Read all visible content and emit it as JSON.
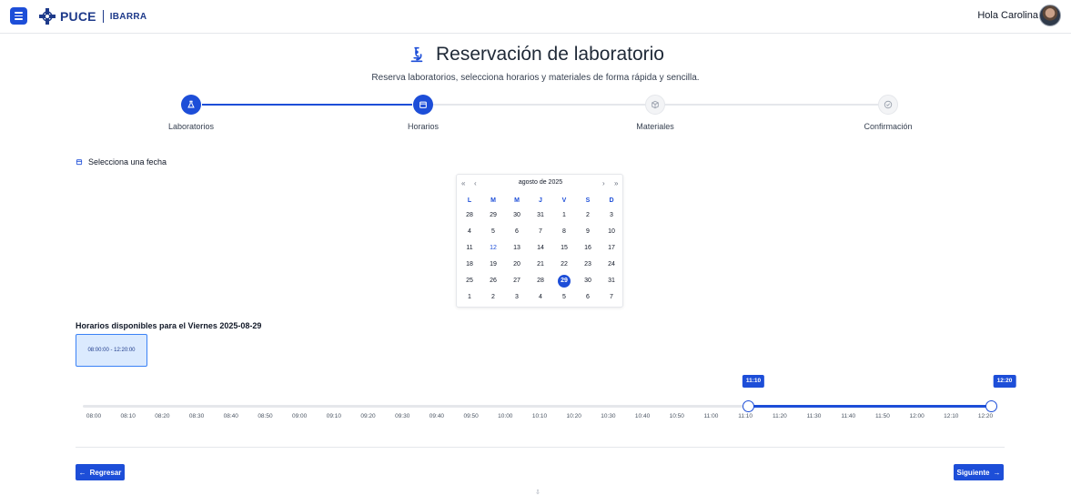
{
  "header": {
    "brand": "PUCE",
    "brand_sub": "IBARRA",
    "greeting": "Hola Carolina",
    "menu_icon": "hamburger-icon"
  },
  "page": {
    "title": "Reservación de laboratorio",
    "title_icon": "microscope-icon",
    "subtitle": "Reserva laboratorios, selecciona horarios y materiales de forma rápida y sencilla."
  },
  "stepper": {
    "steps": [
      {
        "label": "Laboratorios",
        "icon": "flask-icon",
        "state": "completed"
      },
      {
        "label": "Horarios",
        "icon": "calendar-icon",
        "state": "active"
      },
      {
        "label": "Materiales",
        "icon": "box-icon",
        "state": "pending"
      },
      {
        "label": "Confirmación",
        "icon": "check-circle-icon",
        "state": "pending"
      }
    ]
  },
  "date_section": {
    "label": "Selecciona una fecha"
  },
  "calendar": {
    "month_label": "agosto de 2025",
    "nav": {
      "prev_year": "«",
      "prev_month": "‹",
      "next_month": "›",
      "next_year": "»"
    },
    "weekdays": [
      "L",
      "M",
      "M",
      "J",
      "V",
      "S",
      "D"
    ],
    "weeks": [
      [
        "28",
        "29",
        "30",
        "31",
        "1",
        "2",
        "3"
      ],
      [
        "4",
        "5",
        "6",
        "7",
        "8",
        "9",
        "10"
      ],
      [
        "11",
        "12",
        "13",
        "14",
        "15",
        "16",
        "17"
      ],
      [
        "18",
        "19",
        "20",
        "21",
        "22",
        "23",
        "24"
      ],
      [
        "25",
        "26",
        "27",
        "28",
        "29",
        "30",
        "31"
      ],
      [
        "1",
        "2",
        "3",
        "4",
        "5",
        "6",
        "7"
      ]
    ],
    "today": "12",
    "selected": "29"
  },
  "slots": {
    "title": "Horarios disponibles para el Viernes 2025-08-29",
    "items": [
      "08:00:00 - 12:20:00"
    ]
  },
  "range": {
    "ticks": [
      "08:00",
      "08:10",
      "08:20",
      "08:30",
      "08:40",
      "08:50",
      "09:00",
      "09:10",
      "09:20",
      "09:30",
      "09:40",
      "09:50",
      "10:00",
      "10:10",
      "10:20",
      "10:30",
      "10:40",
      "10:50",
      "11:00",
      "11:10",
      "11:20",
      "11:30",
      "11:40",
      "11:50",
      "12:00",
      "12:10",
      "12:20"
    ],
    "start": "11:10",
    "end": "12:20",
    "start_index": 19,
    "end_index": 26
  },
  "actions": {
    "back_label": "Regresar",
    "back_icon": "arrow-left-icon",
    "next_label": "Siguiente",
    "next_icon": "arrow-right-icon"
  },
  "colors": {
    "primary": "#1d4ed8",
    "slot_bg": "#dbeafe"
  }
}
